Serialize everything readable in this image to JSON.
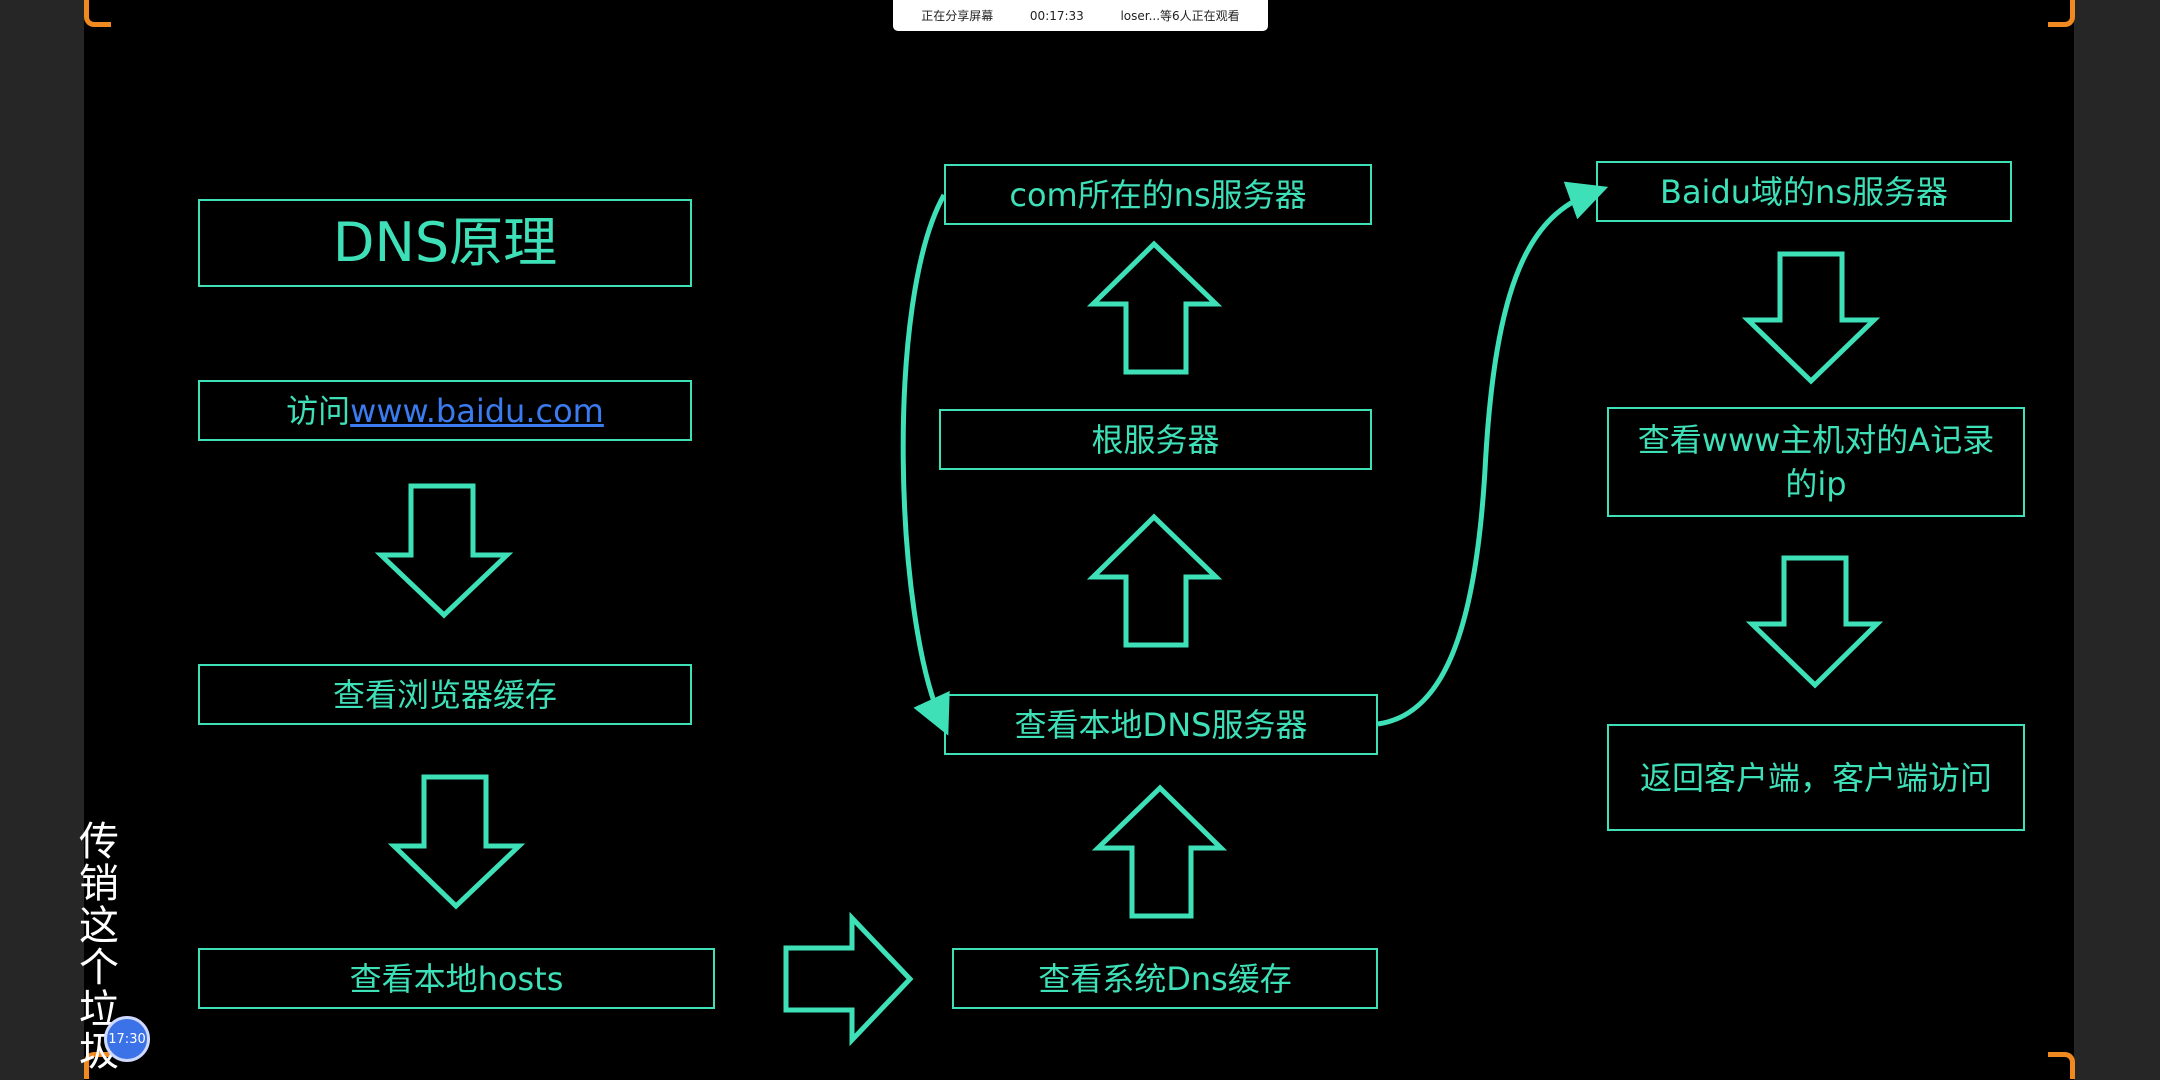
{
  "share_bar": {
    "status": "正在分享屏幕",
    "elapsed": "00:17:33",
    "viewers": "loser...等6人正在观看"
  },
  "diagram": {
    "title": "DNS原理",
    "visit_prefix": "访问",
    "visit_link": "www.baidu.com",
    "browser_cache": "查看浏览器缓存",
    "local_hosts": "查看本地hosts",
    "system_dns_cache": "查看系统Dns缓存",
    "local_dns_server": "查看本地DNS服务器",
    "root_server": "根服务器",
    "com_ns_server": "com所在的ns服务器",
    "baidu_ns_server": "Baidu域的ns服务器",
    "www_a_record": "查看www主机对的A记录的ip",
    "return_client": "返回客户端，客户端访问"
  },
  "side_text": "传销这个垃圾",
  "clock": "17:30",
  "colors": {
    "accent": "#3ee0b8",
    "link": "#3b7bf0",
    "frame": "#f08a20"
  }
}
